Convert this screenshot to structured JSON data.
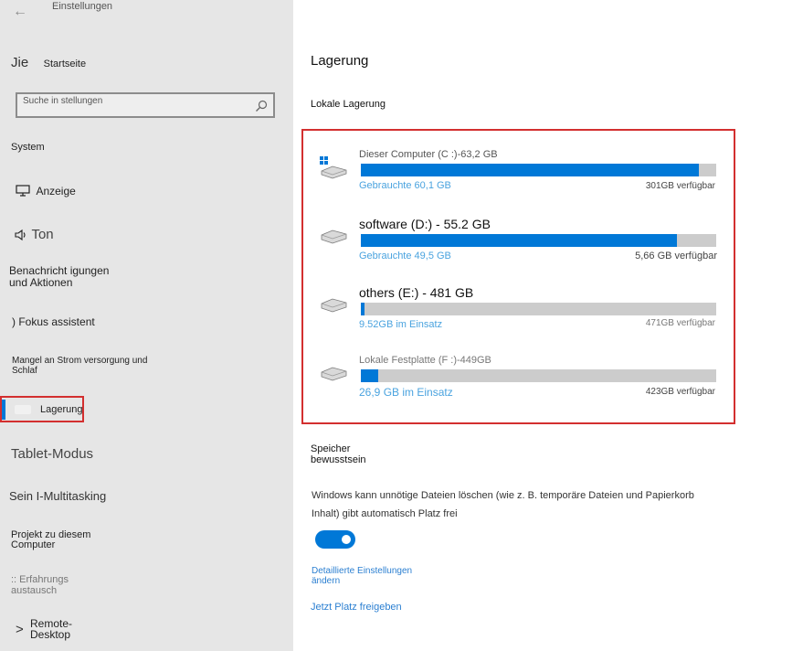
{
  "window": {
    "title": "Einstellungen",
    "back_icon": "←"
  },
  "sidebar": {
    "home": {
      "icon": "Jie",
      "label": "Startseite"
    },
    "search": {
      "placeholder": "Suche in stellungen"
    },
    "section": "System",
    "items": [
      {
        "label": "Anzeige",
        "icon": "monitor-icon"
      },
      {
        "label": "Ton",
        "icon": "speaker-icon"
      },
      {
        "label": "Benachricht igungen und Aktionen"
      },
      {
        "label": ") Fokus assistent"
      },
      {
        "label": "Mangel an Strom versorgung und Schlaf"
      },
      {
        "label": "Lagerung",
        "selected": true
      },
      {
        "label": "Tablet-Modus"
      },
      {
        "label": "Sein I-Multitasking"
      },
      {
        "label": "Projekt zu diesem Computer"
      },
      {
        "label": ":: Erfahrungs austausch"
      },
      {
        "label": "Remote-Desktop"
      }
    ]
  },
  "main": {
    "title": "Lagerung",
    "local_storage": "Lokale Lagerung",
    "drives": [
      {
        "name": "Dieser Computer (C :)-63,2 GB",
        "used_label": "Gebrauchte 60,1 GB",
        "free_label": "301GB verfügbar",
        "fill_fraction": 0.95,
        "windows_logo": true
      },
      {
        "name": "software (D:) - 55.2 GB",
        "used_label": "Gebrauchte 49,5 GB",
        "free_label": "5,66 GB verfügbar",
        "fill_fraction": 0.89
      },
      {
        "name": "others (E:) - 481 GB",
        "used_label": "9.52GB im Einsatz",
        "free_label": "471GB verfügbar",
        "fill_fraction": 0.01
      },
      {
        "name": "Lokale Festplatte (F :)-449GB",
        "used_label": "26,9 GB im Einsatz",
        "free_label": "423GB verfügbar",
        "fill_fraction": 0.05
      }
    ],
    "storage_sense": {
      "title": "Speicher bewusstsein",
      "description": "Windows kann unnötige Dateien löschen (wie z. B. temporäre Dateien und Papierkorb Inhalt) gibt automatisch Platz frei",
      "toggle_on": true,
      "link_settings": "Detaillierte Einstellungen ändern",
      "link_free": "Jetzt Platz freigeben"
    }
  },
  "colors": {
    "accent": "#0078d7",
    "highlight_border": "#d32f2f",
    "link": "#2b7fd1",
    "used_text": "#4aa3df"
  }
}
